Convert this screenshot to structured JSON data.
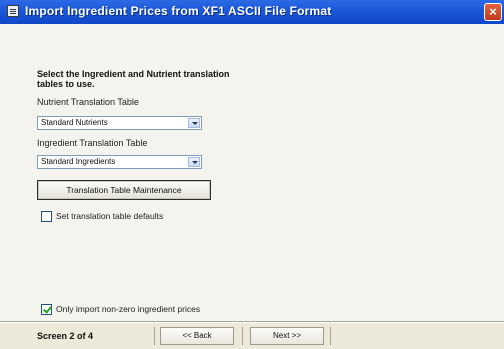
{
  "window": {
    "title": "Import Ingredient Prices from XF1 ASCII File Format",
    "close_glyph": "×"
  },
  "main": {
    "heading": "Select the Ingredient and Nutrient translation tables to use.",
    "nutrient_table": {
      "label": "Nutrient Translation Table",
      "value": "Standard Nutrients"
    },
    "ingredient_table": {
      "label": "Ingredient Translation Table",
      "value": "Standard Ingredients"
    },
    "maintenance_button": "Translation Table Maintenance",
    "set_defaults": {
      "label": "Set translation table defaults",
      "checked": false
    },
    "only_nonzero": {
      "label": "Only import non-zero ingredient prices",
      "checked": true
    }
  },
  "footer": {
    "screen_label": "Screen 2 of 4",
    "back_label": "<< Back",
    "next_label": "Next >>"
  }
}
